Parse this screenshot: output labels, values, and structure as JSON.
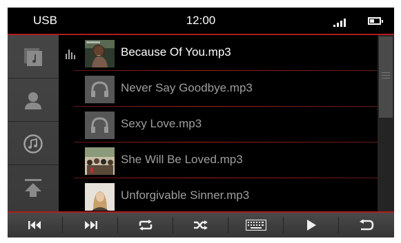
{
  "status_bar": {
    "source": "USB",
    "time": "12:00",
    "signal_icon": "signal-bars-icon",
    "battery_icon": "battery-icon"
  },
  "sidebar": {
    "items": [
      {
        "name": "albums",
        "icon": "album-icon"
      },
      {
        "name": "artists",
        "icon": "artist-icon"
      },
      {
        "name": "songs",
        "icon": "music-note-icon"
      },
      {
        "name": "up",
        "icon": "up-arrow-icon"
      }
    ]
  },
  "playlist": {
    "songs": [
      {
        "title": "Because Of You.mp3",
        "playing": true
      },
      {
        "title": "Never Say Goodbye.mp3",
        "playing": false
      },
      {
        "title": "Sexy Love.mp3",
        "playing": false
      },
      {
        "title": "She Will Be Loved.mp3",
        "playing": false
      },
      {
        "title": "Unforgivable Sinner.mp3",
        "playing": false
      }
    ]
  },
  "controls": [
    {
      "name": "previous",
      "icon": "skip-back-icon"
    },
    {
      "name": "next",
      "icon": "skip-forward-icon"
    },
    {
      "name": "repeat",
      "icon": "repeat-icon"
    },
    {
      "name": "shuffle",
      "icon": "shuffle-icon"
    },
    {
      "name": "keyboard",
      "icon": "keyboard-icon"
    },
    {
      "name": "play",
      "icon": "play-icon"
    },
    {
      "name": "back",
      "icon": "back-icon"
    }
  ],
  "colors": {
    "accent": "#b01c1c",
    "background": "#000000",
    "current_text": "#ffffff",
    "inactive_text": "#9e9e9e"
  }
}
